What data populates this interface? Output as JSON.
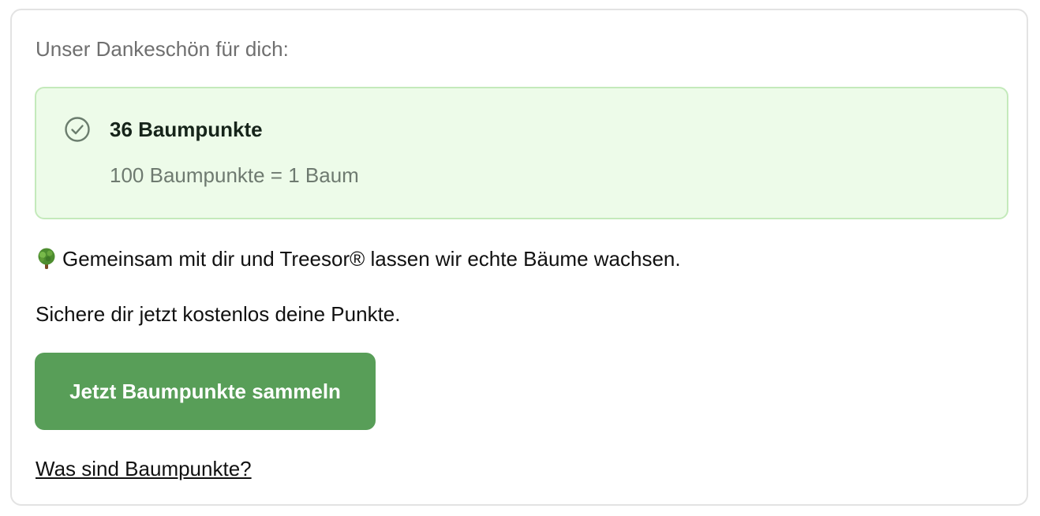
{
  "card": {
    "intro": "Unser Dankeschön für dich:",
    "points": {
      "title": "36 Baumpunkte",
      "subtitle": "100 Baumpunkte = 1 Baum",
      "icon": "check-circle-icon"
    },
    "info_line": "Gemeinsam mit dir und Treesor® lassen wir echte Bäume wachsen.",
    "info_icon": "tree-icon",
    "prompt_line": "Sichere dir jetzt kostenlos deine Punkte.",
    "cta_label": "Jetzt Baumpunkte sammeln",
    "link_label": "Was sind Baumpunkte?"
  },
  "colors": {
    "accent_green": "#589e58",
    "success_bg": "#edfbe9",
    "success_border": "#c4eabb"
  }
}
